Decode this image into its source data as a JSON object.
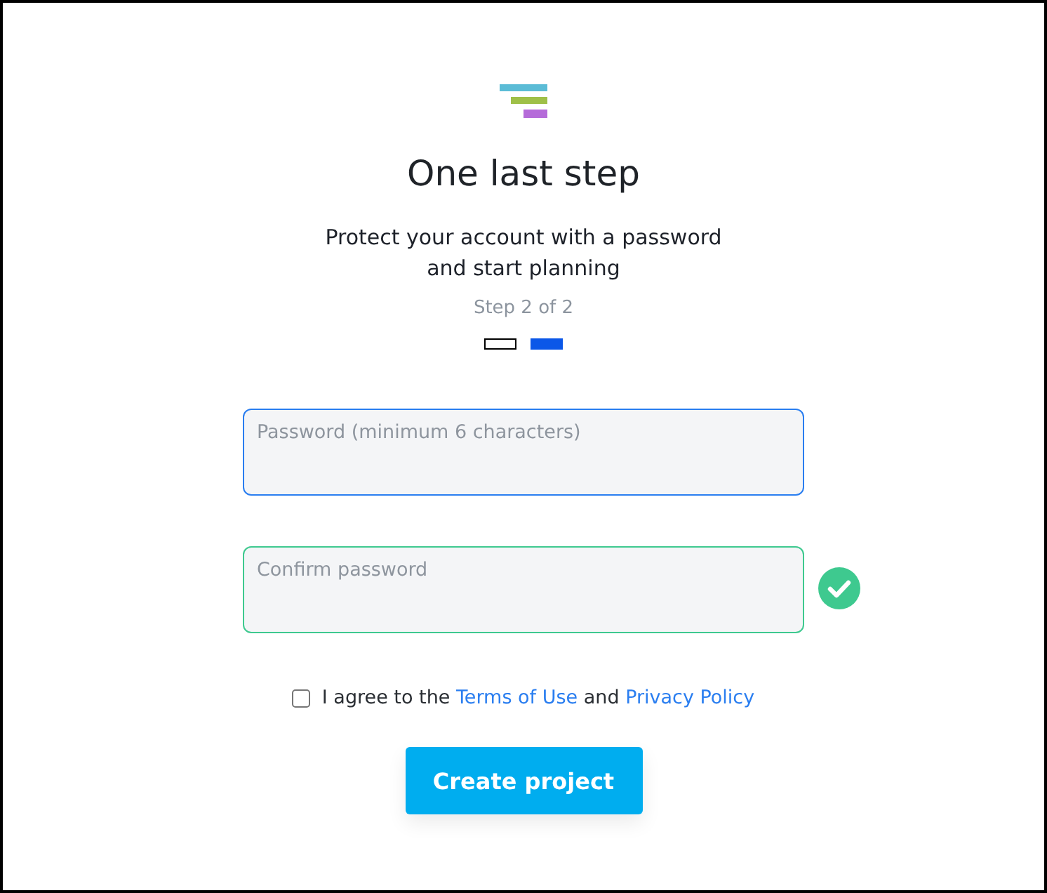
{
  "title": "One last step",
  "subtitle_lines": [
    "Protect your account with a password",
    "and start planning"
  ],
  "step_label": "Step 2 of 2",
  "steps": [
    {
      "selected": false
    },
    {
      "selected": true
    }
  ],
  "fields": [
    {
      "placeholder": "Password (minimum 6 characters)",
      "focused": true,
      "valid": false
    },
    {
      "placeholder": "Confirm password",
      "focused": false,
      "valid": true
    }
  ],
  "agreement": {
    "checked": false,
    "parts": [
      {
        "kind": "text",
        "text": "I agree to the"
      },
      {
        "kind": "link",
        "text": "Terms of Use"
      },
      {
        "kind": "text",
        "text": "and"
      },
      {
        "kind": "link",
        "text": "Privacy Policy"
      }
    ]
  },
  "button": "Create project"
}
